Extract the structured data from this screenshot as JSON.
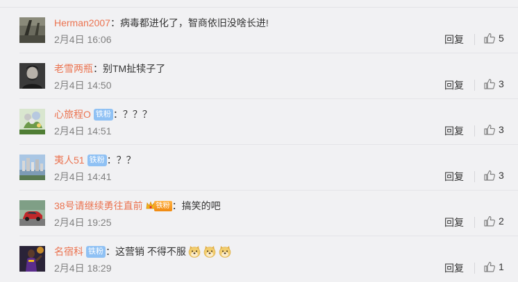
{
  "comments": [
    {
      "username": "Herman2007",
      "badge": null,
      "text": "病毒都进化了，智商依旧没啥长进!",
      "emojis": [],
      "time": "2月4日 16:06",
      "reply_label": "回复",
      "likes": "5"
    },
    {
      "username": "老雪两瓶",
      "badge": null,
      "text": "别TM扯犊子了",
      "emojis": [],
      "time": "2月4日 14:50",
      "reply_label": "回复",
      "likes": "3"
    },
    {
      "username": "心旅程O",
      "badge": "铁粉",
      "text": "？？？",
      "emojis": [],
      "time": "2月4日 14:51",
      "reply_label": "回复",
      "likes": "3"
    },
    {
      "username": "夷人51",
      "badge": "铁粉",
      "text": "？？",
      "emojis": [],
      "time": "2月4日 14:41",
      "reply_label": "回复",
      "likes": "3"
    },
    {
      "username": "38号请继续勇往直前",
      "badge": "铁粉",
      "badge_style": "gold",
      "text": "搞笑的吧",
      "emojis": [],
      "time": "2月4日 19:25",
      "reply_label": "回复",
      "likes": "2"
    },
    {
      "username": "名宿科",
      "badge": "铁粉",
      "text": "这营销 不得不服",
      "emojis": [
        "doge-emoji",
        "doge-emoji",
        "doge-emoji"
      ],
      "time": "2月4日 18:29",
      "reply_label": "回复",
      "likes": "1"
    }
  ],
  "colors": {
    "username": "#eb7350",
    "badge_iron": "#8fc1f4",
    "background": "#f1f1f3"
  },
  "icons": {
    "like": "thumbs-up-icon",
    "emoji": "doge-emoji"
  }
}
